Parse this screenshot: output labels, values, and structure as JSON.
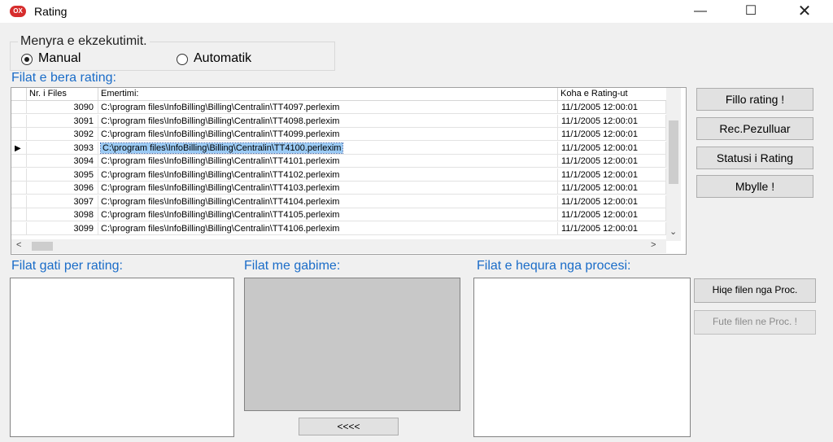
{
  "window": {
    "title": "Rating",
    "app_icon_text": "OX"
  },
  "mode_group": {
    "title": "Menyra e ekzekutimit.",
    "options": [
      {
        "label": "Manual",
        "selected": true
      },
      {
        "label": "Automatik",
        "selected": false
      }
    ]
  },
  "grid_label": "Filat e bera rating:",
  "grid": {
    "columns": [
      "Nr. i Files",
      "Emertimi:",
      "Koha e Rating-ut"
    ],
    "current_row_marker": "▶",
    "rows": [
      {
        "nr": "3090",
        "emertimi": "C:\\program files\\InfoBilling\\Billing\\Centralin\\TT4097.perlexim",
        "koha": "11/1/2005 12:00:01"
      },
      {
        "nr": "3091",
        "emertimi": "C:\\program files\\InfoBilling\\Billing\\Centralin\\TT4098.perlexim",
        "koha": "11/1/2005 12:00:01"
      },
      {
        "nr": "3092",
        "emertimi": "C:\\program files\\InfoBilling\\Billing\\Centralin\\TT4099.perlexim",
        "koha": "11/1/2005 12:00:01"
      },
      {
        "nr": "3093",
        "emertimi": "C:\\program files\\InfoBilling\\Billing\\Centralin\\TT4100.perlexim",
        "koha": "11/1/2005 12:00:01"
      },
      {
        "nr": "3094",
        "emertimi": "C:\\program files\\InfoBilling\\Billing\\Centralin\\TT4101.perlexim",
        "koha": "11/1/2005 12:00:01"
      },
      {
        "nr": "3095",
        "emertimi": "C:\\program files\\InfoBilling\\Billing\\Centralin\\TT4102.perlexim",
        "koha": "11/1/2005 12:00:01"
      },
      {
        "nr": "3096",
        "emertimi": "C:\\program files\\InfoBilling\\Billing\\Centralin\\TT4103.perlexim",
        "koha": "11/1/2005 12:00:01"
      },
      {
        "nr": "3097",
        "emertimi": "C:\\program files\\InfoBilling\\Billing\\Centralin\\TT4104.perlexim",
        "koha": "11/1/2005 12:00:01"
      },
      {
        "nr": "3098",
        "emertimi": "C:\\program files\\InfoBilling\\Billing\\Centralin\\TT4105.perlexim",
        "koha": "11/1/2005 12:00:01"
      },
      {
        "nr": "3099",
        "emertimi": "C:\\program files\\InfoBilling\\Billing\\Centralin\\TT4106.perlexim",
        "koha": "11/1/2005 12:00:01"
      }
    ]
  },
  "actions": {
    "fillo": "Fillo rating !",
    "rec": "Rec.Pezulluar",
    "statusi": "Statusi i Rating",
    "mbylle": "Mbylle !"
  },
  "lists": {
    "gati": "Filat gati per rating:",
    "gabime": "Filat me gabime:",
    "hequra": "Filat e hequra nga procesi:"
  },
  "list_buttons": {
    "hiqe": "Hiqe filen nga Proc.",
    "fute": "Fute filen ne Proc. !",
    "back": "<<<<"
  },
  "colors": {
    "label_blue": "#1a6cc8",
    "selection": "#9bcbf5",
    "close_icon": "#d62d2d"
  }
}
